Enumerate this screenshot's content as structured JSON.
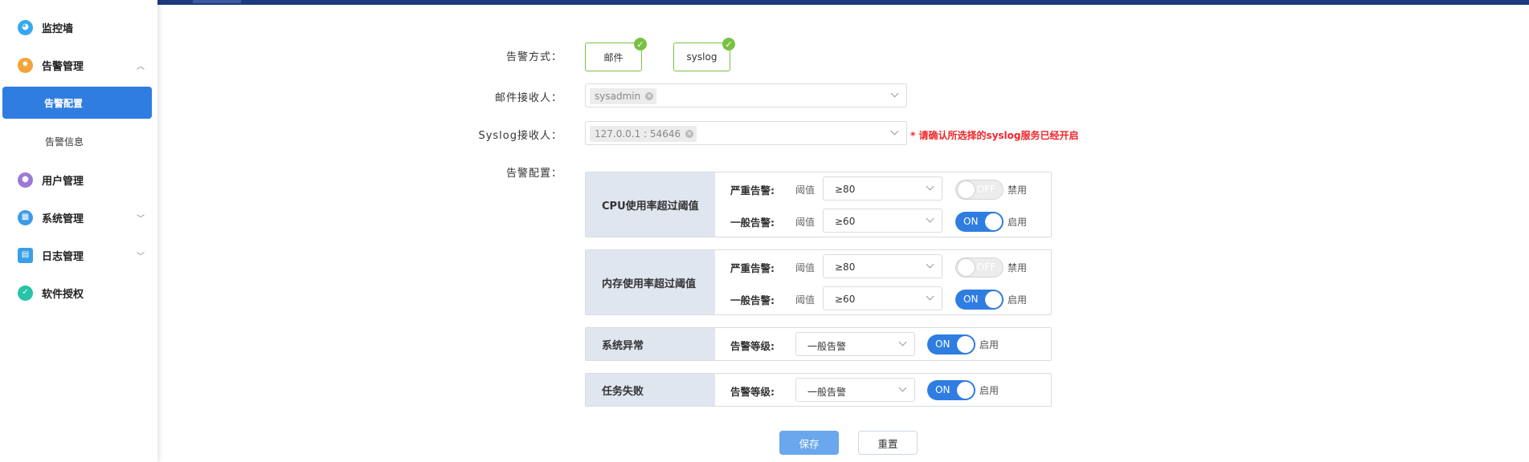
{
  "sidebar": {
    "items": [
      {
        "label": "监控墙",
        "icon": "dashboard-icon",
        "color": "#35a7f0"
      },
      {
        "label": "告警管理",
        "icon": "bell-icon",
        "color": "#f2a33a"
      },
      {
        "label": "用户管理",
        "icon": "user-icon",
        "color": "#9b7ad6"
      },
      {
        "label": "系统管理",
        "icon": "windows-icon",
        "color": "#3c9be8"
      },
      {
        "label": "日志管理",
        "icon": "calendar-icon",
        "color": "#3aa0e6"
      },
      {
        "label": "软件授权",
        "icon": "shield-check-icon",
        "color": "#27c4a7"
      }
    ],
    "sub": {
      "active": "告警配置",
      "other": "告警信息"
    }
  },
  "form": {
    "method_label": "告警方式：",
    "methods": [
      "邮件",
      "syslog"
    ],
    "email_label": "邮件接收人：",
    "email_tag": "sysadmin",
    "syslog_label": "Syslog接收人：",
    "syslog_tag": "127.0.0.1 : 54646",
    "syslog_hint": "* 请确认所选择的syslog服务已经开启",
    "config_label": "告警配置："
  },
  "config": {
    "cpu": {
      "title": "CPU使用率超过阈值",
      "severe_label": "严重告警:",
      "severe_threshold_label": "阈值",
      "severe_value": "≥80",
      "severe_toggle": "OFF",
      "severe_state": "禁用",
      "normal_label": "一般告警:",
      "normal_threshold_label": "阈值",
      "normal_value": "≥60",
      "normal_toggle": "ON",
      "normal_state": "启用"
    },
    "mem": {
      "title": "内存使用率超过阈值",
      "severe_label": "严重告警:",
      "severe_threshold_label": "阈值",
      "severe_value": "≥80",
      "severe_toggle": "OFF",
      "severe_state": "禁用",
      "normal_label": "一般告警:",
      "normal_threshold_label": "阈值",
      "normal_value": "≥60",
      "normal_toggle": "ON",
      "normal_state": "启用"
    },
    "sys": {
      "title": "系统异常",
      "level_label": "告警等级:",
      "level_value": "一般告警",
      "toggle": "ON",
      "state": "启用"
    },
    "task": {
      "title": "任务失败",
      "level_label": "告警等级:",
      "level_value": "一般告警",
      "toggle": "ON",
      "state": "启用"
    }
  },
  "actions": {
    "save": "保存",
    "reset": "重置"
  },
  "colors": {
    "primary": "#2f7de1",
    "check": "#7ac143",
    "hint": "#f0262a"
  }
}
